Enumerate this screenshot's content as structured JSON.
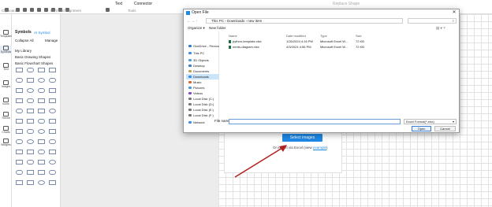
{
  "ribbon": {
    "group_clipboard": "Clipboard",
    "group_font": "Font and Alignment",
    "group_tools": "Tools",
    "text_label": "Text",
    "connector_label": "Connector",
    "replace_shape": "Replace Shape"
  },
  "iconbar": {
    "items": [
      "Templates",
      "Symbols",
      "Text",
      "Images",
      "Icons",
      "Theme",
      "Charts",
      "Widgets"
    ]
  },
  "symbols": {
    "title": "Symbols",
    "ai_symbol": "AI Symbol",
    "collapse_all": "Collapse All",
    "manage": "Manage",
    "categories": [
      "My Library",
      "Basic Drawing Shapes",
      "Basic Flowchart Shapes"
    ]
  },
  "dialog": {
    "title": "Open File",
    "close_glyph": "✕",
    "breadcrumb": [
      "This PC",
      "Downloads",
      "new item"
    ],
    "organize": "Organize ▾",
    "new_folder": "New folder",
    "nav_items": [
      "OneDrive - Person",
      "This PC",
      "3D Objects",
      "Desktop",
      "Documents",
      "Downloads",
      "Music",
      "Pictures",
      "Videos",
      "Local Disk (C:)",
      "Local Disk (D:)",
      "Local Disk (E:)",
      "Local Disk (F:)",
      "Network"
    ],
    "selected_nav": "Downloads",
    "columns": [
      "Name",
      "Date modified",
      "Type",
      "Size"
    ],
    "files": [
      {
        "name": "python-template.xlsx",
        "date": "1/26/2024 4:16 PM",
        "type": "Microsoft Excel W...",
        "size": "72 KB"
      },
      {
        "name": "nerds-diagram.xlsx",
        "date": "4/3/2024 4:56 PM",
        "type": "Microsoft Excel W...",
        "size": "72 KB"
      }
    ],
    "file_name_label": "File name:",
    "file_name_value": "",
    "file_type": "Excel Format(*.xlsx)",
    "open_btn": "Open",
    "cancel_btn": "Cancel"
  },
  "import_card": {
    "select_images": "Select images",
    "or_import": "Or import via Excel (view",
    "example_link": "example",
    "closing": ")"
  },
  "colors": {
    "accent": "#1e88e5",
    "arrow": "#b22222"
  }
}
